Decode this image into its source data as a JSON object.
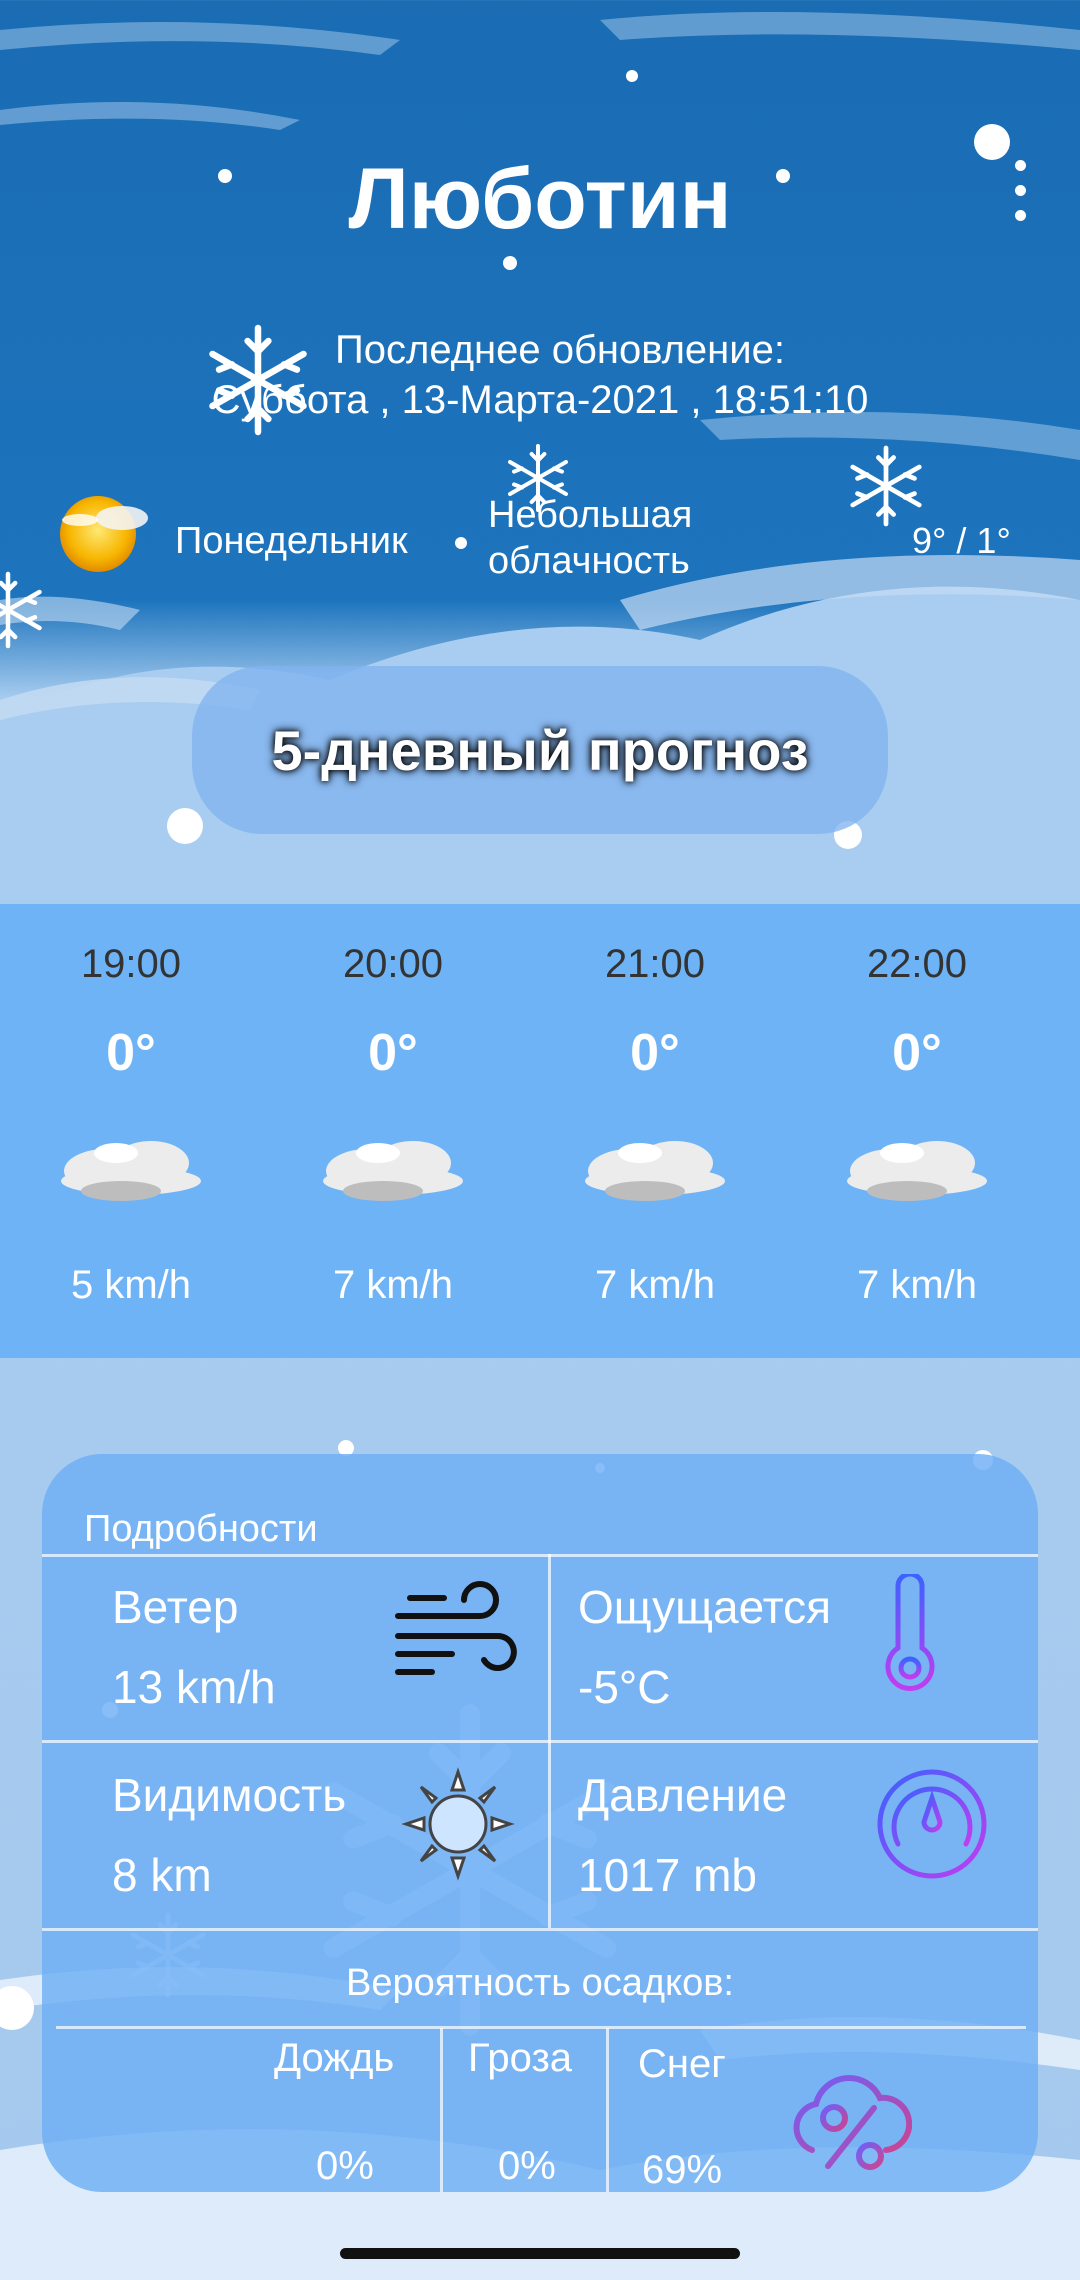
{
  "header": {
    "city": "Люботин",
    "update_label": "Последнее обновление:",
    "update_time": "Суббота , 13-Марта-2021 , 18:51:10"
  },
  "today": {
    "icon": "sun-cloud-icon",
    "day": "Понедельник",
    "condition_line1": "Небольшая",
    "condition_line2": "облачность",
    "temp_range": "9° / 1°"
  },
  "forecast_button": {
    "label": "5-дневный прогноз"
  },
  "hourly": [
    {
      "time": "19:00",
      "temp": "0°",
      "icon": "cloud-icon",
      "wind": "5 km/h"
    },
    {
      "time": "20:00",
      "temp": "0°",
      "icon": "cloud-icon",
      "wind": "7 km/h"
    },
    {
      "time": "21:00",
      "temp": "0°",
      "icon": "cloud-icon",
      "wind": "7 km/h"
    },
    {
      "time": "22:00",
      "temp": "0°",
      "icon": "cloud-icon",
      "wind": "7 km/h"
    }
  ],
  "details": {
    "title": "Подробности",
    "wind": {
      "label": "Ветер",
      "value": "13 km/h",
      "icon": "wind-icon"
    },
    "feels": {
      "label": "Ощущается",
      "value": "-5°C",
      "icon": "thermometer-icon"
    },
    "visibility": {
      "label": "Видимость",
      "value": "8 km",
      "icon": "sun-icon"
    },
    "pressure": {
      "label": "Давление",
      "value": "1017 mb",
      "icon": "gauge-icon"
    },
    "precip": {
      "title": "Вероятность осадков:",
      "rain": {
        "label": "Дождь",
        "value": "0%"
      },
      "storm": {
        "label": "Гроза",
        "value": "0%"
      },
      "snow": {
        "label": "Снег",
        "value": "69%"
      },
      "icon": "cloud-percent-icon"
    }
  },
  "colors": {
    "sky": "#1d74bd",
    "panel": "#6eb3f6",
    "light": "#a5c9ee",
    "accent": "#8a3cf0"
  }
}
